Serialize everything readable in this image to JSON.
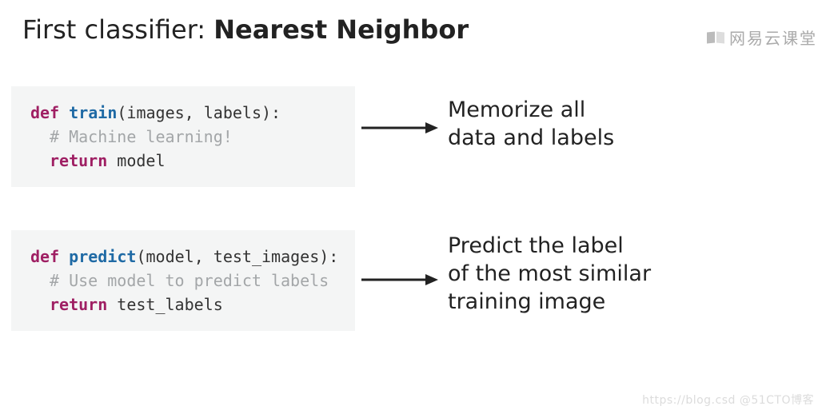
{
  "title": {
    "prefix": "First classifier: ",
    "strong": "Nearest Neighbor"
  },
  "brand": "网易云课堂",
  "code1": {
    "def": "def",
    "fn": "train",
    "sig": "(images, labels):",
    "comment": "# Machine learning!",
    "ret": "return",
    "retv": "model"
  },
  "desc1": {
    "l1": "Memorize all",
    "l2": "data and labels"
  },
  "code2": {
    "def": "def",
    "fn": "predict",
    "sig": "(model, test_images):",
    "comment": "# Use model to predict labels",
    "ret": "return",
    "retv": "test_labels"
  },
  "desc2": {
    "l1": "Predict the label",
    "l2": "of the most similar",
    "l3": "training image"
  },
  "watermark": "https://blog.csd @51CTO博客"
}
